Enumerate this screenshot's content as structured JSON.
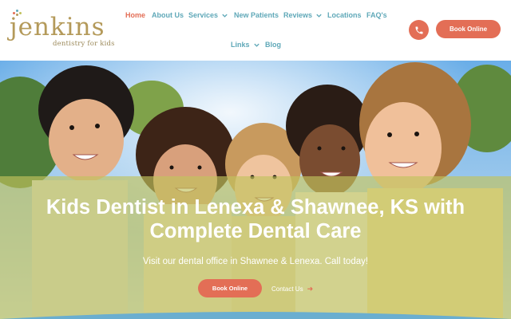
{
  "brand": {
    "name": "jenkins",
    "tagline": "dentistry for kids",
    "dot_colors": [
      "#e36e56",
      "#5fa8b8",
      "#b49a5a",
      "#c1c25d"
    ]
  },
  "nav": {
    "items": [
      {
        "label": "Home",
        "active": true
      },
      {
        "label": "About Us"
      },
      {
        "label": "Services",
        "dropdown": true
      },
      {
        "label": "New Patients"
      },
      {
        "label": "Reviews",
        "dropdown": true
      },
      {
        "label": "Locations"
      },
      {
        "label": "FAQ's"
      },
      {
        "label": "Links",
        "dropdown": true
      },
      {
        "label": "Blog"
      }
    ]
  },
  "header_actions": {
    "phone_icon": "phone-icon",
    "book_label": "Book Online"
  },
  "hero": {
    "title_line1": "Kids Dentist in Lenexa & Shawnee, KS with",
    "title_line2": "Complete Dental Care",
    "subtitle": "Visit our dental office in Shawnee & Lenexa. Call today!",
    "book_label": "Book Online",
    "contact_label": "Contact Us",
    "contact_icon": "arrow-right-icon"
  },
  "colors": {
    "accent": "#e36e56",
    "nav_link": "#5fa8b8",
    "logo": "#b49a5a",
    "overlay": "#c1c25d"
  }
}
